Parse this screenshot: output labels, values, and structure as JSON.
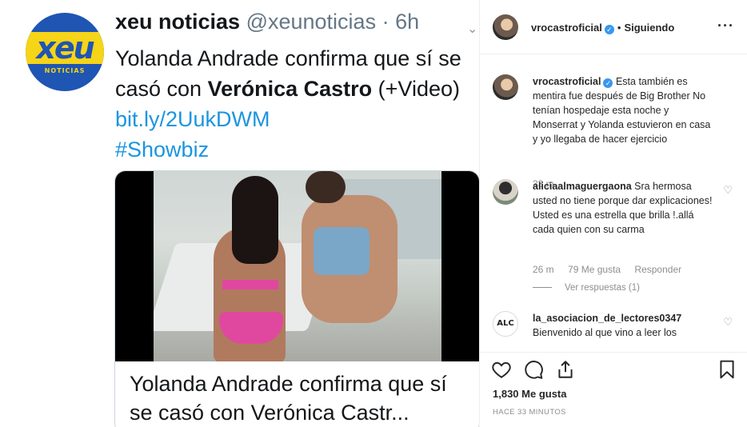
{
  "tweet": {
    "logo_text": "xeu",
    "logo_subtext": "NOTICIAS",
    "name": "xeu noticias",
    "handle": "@xeunoticias",
    "time": "6h",
    "body_part1": "Yolanda Andrade confirma que sí se casó con ",
    "body_bold": "Verónica Castro",
    "body_part2": " (+Video) ",
    "link": "bit.ly/2UukDWM",
    "hashtag": "#Showbiz",
    "card_title": "Yolanda Andrade confirma que sí se casó con Verónica Castr..."
  },
  "header": {
    "username": "vrocastroficial",
    "follow_status": "Siguiendo"
  },
  "comments": [
    {
      "username": "vrocastroficial",
      "verified": true,
      "text": "Esta también es mentira fue después de Big Brother No tenían hospedaje esta noche y Monserrat y Yolanda estuvieron en casa y yo llegaba de hacer ejercicio",
      "time": "33 m"
    },
    {
      "username": "aliciaalmaguergaona",
      "text": "Sra hermosa usted no tiene porque dar explicaciones! Usted es una estrella que brilla !.allá cada quien con su carma",
      "time": "26 m",
      "likes": "79 Me gusta",
      "reply": "Responder",
      "view_replies": "Ver respuestas (1)"
    },
    {
      "username": "la_asociacion_de_lectores0347",
      "avatar_text": "ALC",
      "text": "Bienvenido al que vino a leer los"
    }
  ],
  "footer": {
    "likes": "1,830 Me gusta",
    "time_ago": "HACE 33 MINUTOS"
  }
}
